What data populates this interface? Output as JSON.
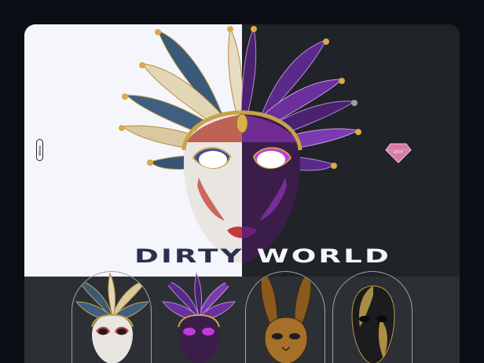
{
  "nav": {
    "menu_label": "MENU",
    "mint_label": "MINT"
  },
  "hero": {
    "title": "DIRTY WORLD"
  },
  "colors": {
    "page_bg": "#0b0e14",
    "hero_left_bg": "#f4f6fb",
    "hero_right_bg": "#202327",
    "title_dark": "#2c2f4d",
    "mint_pink": "#d77ba6",
    "gallery_bg": "#2c2f34"
  },
  "gallery": {
    "items": [
      {
        "name": "jester-mask-blue-gold",
        "icon": "jester-mask"
      },
      {
        "name": "jester-mask-purple",
        "icon": "jester-mask"
      },
      {
        "name": "gold-rabbit-mask",
        "icon": "rabbit-mask"
      },
      {
        "name": "black-gold-mask",
        "icon": "full-face-mask"
      }
    ]
  }
}
